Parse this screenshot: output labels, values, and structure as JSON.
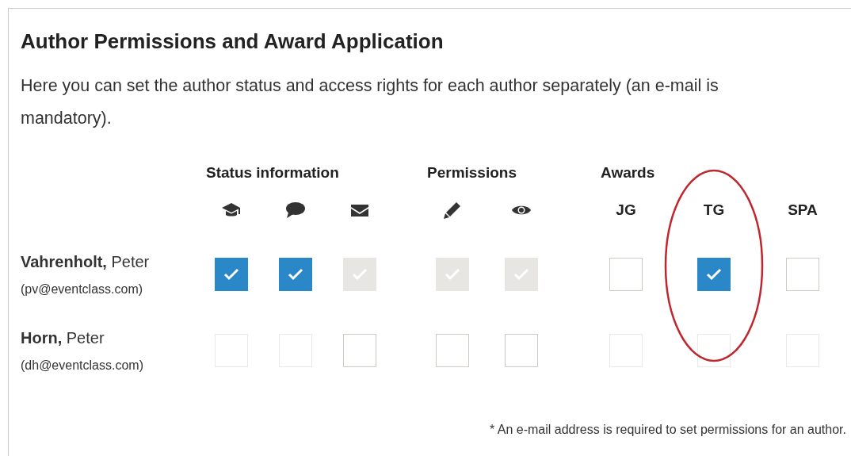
{
  "title": "Author Permissions and Award Application",
  "intro": "Here you can set the author status and access rights for each author separately (an e-mail is mandatory).",
  "groups": [
    {
      "label": "Status information"
    },
    {
      "label": "Permissions"
    },
    {
      "label": "Awards"
    }
  ],
  "columns": [
    {
      "kind": "icon"
    },
    {
      "kind": "icon"
    },
    {
      "kind": "icon"
    },
    {
      "kind": "icon"
    },
    {
      "kind": "icon"
    },
    {
      "kind": "text",
      "label": "JG"
    },
    {
      "kind": "text",
      "label": "TG",
      "circled": true
    },
    {
      "kind": "text",
      "label": "SPA"
    }
  ],
  "authors": [
    {
      "name": "**Vahrenholt,** Peter",
      "email": "(pv@eventclass.com)",
      "boxes": [
        {
          "checked": true,
          "disabled": false
        },
        {
          "checked": true,
          "disabled": false
        },
        {
          "checked": true,
          "disabled": true
        },
        {
          "checked": true,
          "disabled": true
        },
        {
          "checked": true,
          "disabled": true
        },
        {
          "checked": false,
          "disabled": false
        },
        {
          "checked": true,
          "disabled": false
        },
        {
          "checked": false,
          "disabled": false
        }
      ]
    },
    {
      "name": "**Horn,** Peter",
      "email": "(dh@eventclass.com)",
      "boxes": [
        {
          "checked": false,
          "disabled": true
        },
        {
          "checked": false,
          "disabled": true
        },
        {
          "checked": false,
          "disabled": false
        },
        {
          "checked": false,
          "disabled": false
        },
        {
          "checked": false,
          "disabled": false
        },
        {
          "checked": false,
          "disabled": true
        },
        {
          "checked": false,
          "disabled": true
        },
        {
          "checked": false,
          "disabled": true
        }
      ]
    }
  ],
  "footnote": "* An e-mail address is required to set permissions for an author."
}
